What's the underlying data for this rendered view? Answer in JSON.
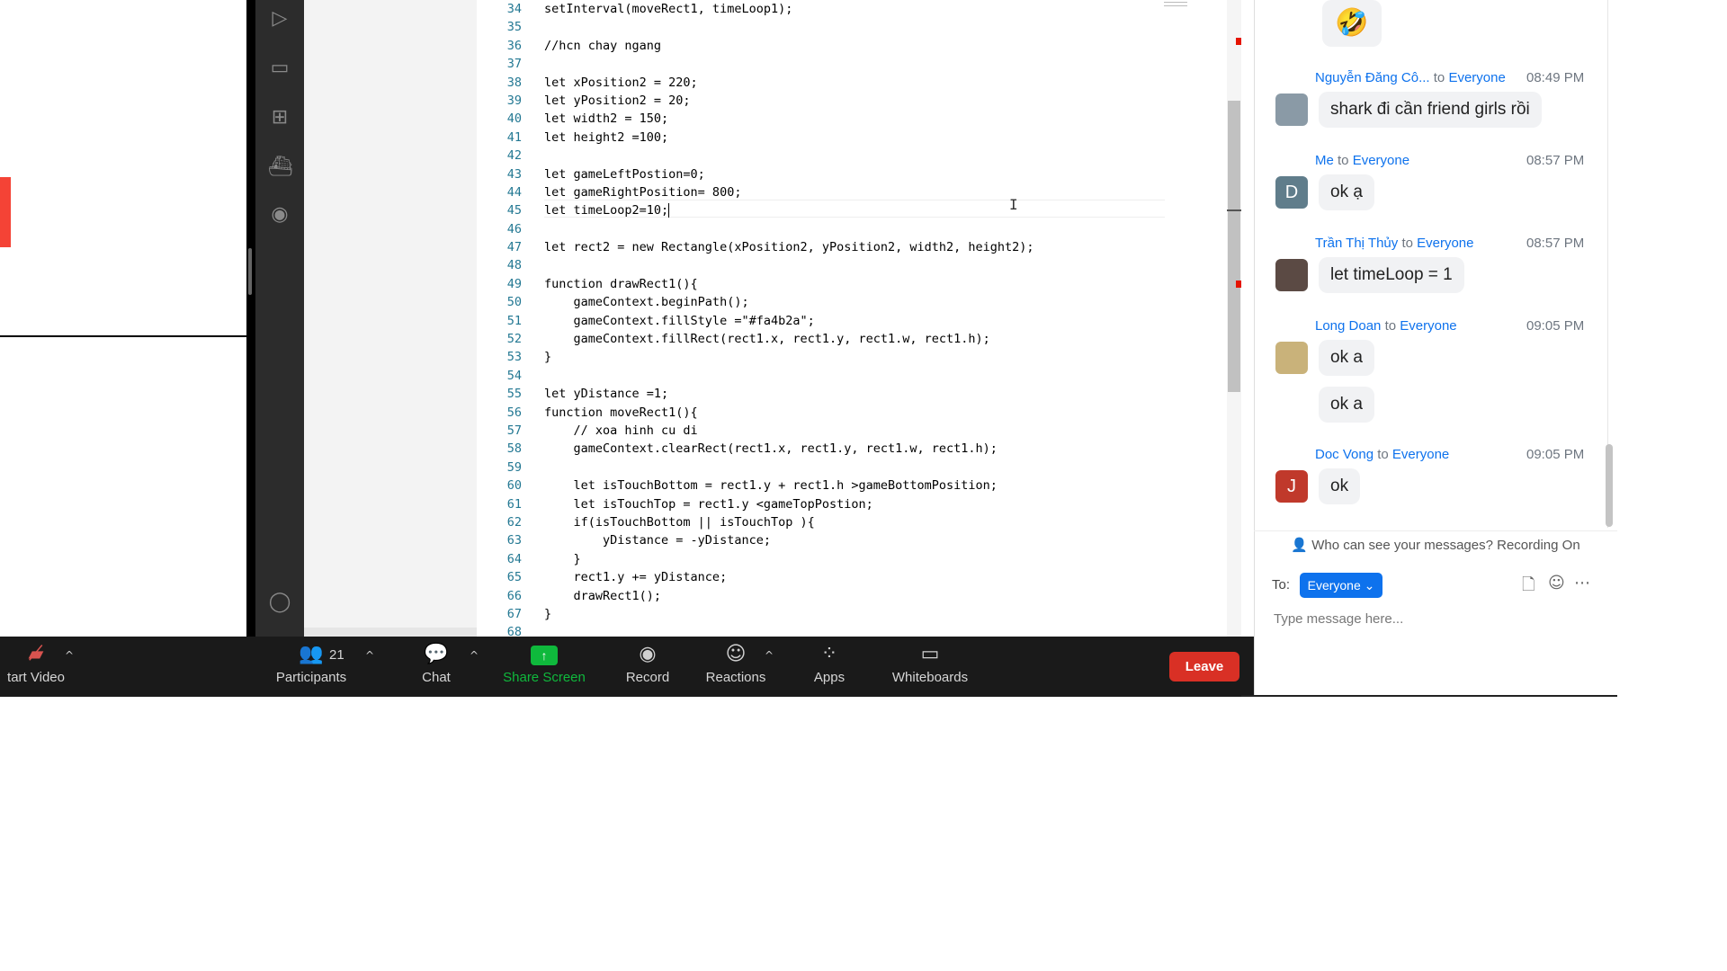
{
  "editor": {
    "lines": [
      {
        "n": "34",
        "code": "setInterval(moveRect1, timeLoop1);"
      },
      {
        "n": "35",
        "code": ""
      },
      {
        "n": "36",
        "code": "//hcn chay ngang"
      },
      {
        "n": "37",
        "code": ""
      },
      {
        "n": "38",
        "code": "let xPosition2 = 220;"
      },
      {
        "n": "39",
        "code": "let yPosition2 = 20;"
      },
      {
        "n": "40",
        "code": "let width2 = 150;"
      },
      {
        "n": "41",
        "code": "let height2 =100;"
      },
      {
        "n": "42",
        "code": ""
      },
      {
        "n": "43",
        "code": "let gameLeftPostion=0;"
      },
      {
        "n": "44",
        "code": "let gameRightPosition= 800;"
      },
      {
        "n": "45",
        "code": "let timeLoop2=10;"
      },
      {
        "n": "46",
        "code": ""
      },
      {
        "n": "47",
        "code": "let rect2 = new Rectangle(xPosition2, yPosition2, width2, height2);"
      },
      {
        "n": "48",
        "code": ""
      },
      {
        "n": "49",
        "code": "function drawRect1(){"
      },
      {
        "n": "50",
        "code": "    gameContext.beginPath();"
      },
      {
        "n": "51",
        "code": "    gameContext.fillStyle =\"#fa4b2a\";"
      },
      {
        "n": "52",
        "code": "    gameContext.fillRect(rect1.x, rect1.y, rect1.w, rect1.h);"
      },
      {
        "n": "53",
        "code": "}"
      },
      {
        "n": "54",
        "code": ""
      },
      {
        "n": "55",
        "code": "let yDistance =1;"
      },
      {
        "n": "56",
        "code": "function moveRect1(){"
      },
      {
        "n": "57",
        "code": "    // xoa hinh cu di"
      },
      {
        "n": "58",
        "code": "    gameContext.clearRect(rect1.x, rect1.y, rect1.w, rect1.h);"
      },
      {
        "n": "59",
        "code": ""
      },
      {
        "n": "60",
        "code": "    let isTouchBottom = rect1.y + rect1.h >gameBottomPosition;"
      },
      {
        "n": "61",
        "code": "    let isTouchTop = rect1.y <gameTopPostion;"
      },
      {
        "n": "62",
        "code": "    if(isTouchBottom || isTouchTop ){"
      },
      {
        "n": "63",
        "code": "        yDistance = -yDistance;"
      },
      {
        "n": "64",
        "code": "    }"
      },
      {
        "n": "65",
        "code": "    rect1.y += yDistance;"
      },
      {
        "n": "66",
        "code": "    drawRect1();"
      },
      {
        "n": "67",
        "code": "}"
      },
      {
        "n": "68",
        "code": ""
      }
    ],
    "active_line": "45",
    "icons": [
      "run-debug-icon",
      "remote-explorer-icon",
      "extensions-icon",
      "docker-icon",
      "github-icon",
      "account-icon"
    ]
  },
  "toolbar": {
    "video_label": "tart Video",
    "participants_label": "Participants",
    "participants_count": "21",
    "chat_label": "Chat",
    "share_label": "Share Screen",
    "record_label": "Record",
    "reactions_label": "Reactions",
    "apps_label": "Apps",
    "whiteboards_label": "Whiteboards",
    "leave_label": "Leave",
    "share_color": "#0fb93c",
    "leave_color": "#d93025"
  },
  "chat": {
    "top_emoji": "🤣",
    "messages": [
      {
        "sender": "Nguyễn Đăng Cô...",
        "to": "to",
        "target": "Everyone",
        "time": "08:49 PM",
        "avatar_letter": "",
        "avatar_color": "#8a9aa6",
        "bubbles": [
          "shark đi cần friend girls rồi"
        ]
      },
      {
        "sender": "Me",
        "to": "to",
        "target": "Everyone",
        "time": "08:57 PM",
        "avatar_letter": "D",
        "avatar_color": "#607d8b",
        "bubbles": [
          "ok ạ"
        ]
      },
      {
        "sender": "Trần Thị Thủy",
        "to": "to",
        "target": "Everyone",
        "time": "08:57 PM",
        "avatar_letter": "",
        "avatar_color": "#5b4a44",
        "bubbles": [
          "let timeLoop = 1"
        ]
      },
      {
        "sender": "Long Doan",
        "to": "to",
        "target": "Everyone",
        "time": "09:05 PM",
        "avatar_letter": "",
        "avatar_color": "#c9b27a",
        "bubbles": [
          "ok a",
          "ok a"
        ]
      },
      {
        "sender": "Doc Vong",
        "to": "to",
        "target": "Everyone",
        "time": "09:05 PM",
        "avatar_letter": "J",
        "avatar_color": "#c0392b",
        "bubbles": [
          "ok"
        ]
      }
    ],
    "privacy_text": "Who can see your messages? Recording On",
    "to_label": "To:",
    "to_value": "Everyone",
    "input_placeholder": "Type message here...",
    "accent_color": "#0e72ed"
  }
}
